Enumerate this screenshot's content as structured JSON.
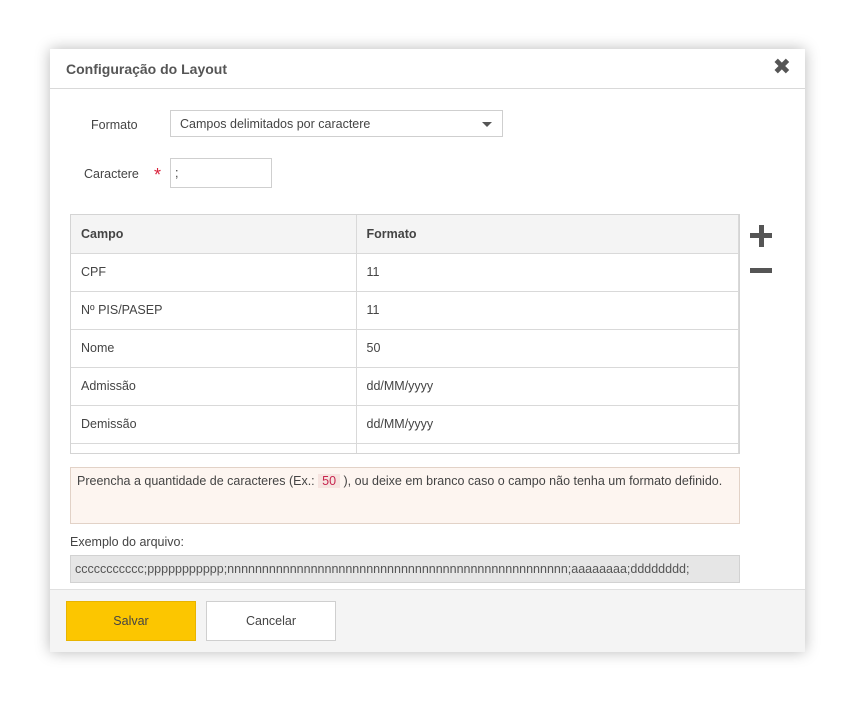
{
  "dialog": {
    "title": "Configuração do Layout",
    "close_icon": "close-icon"
  },
  "form": {
    "format_label": "Formato",
    "format_value": "Campos delimitados por caractere",
    "char_label": "Caractere",
    "char_value": ";"
  },
  "table": {
    "headers": [
      "Campo",
      "Formato"
    ],
    "rows": [
      [
        "CPF",
        "11"
      ],
      [
        "Nº PIS/PASEP",
        "11"
      ],
      [
        "Nome",
        "50"
      ],
      [
        "Admissão",
        "dd/MM/yyyy"
      ],
      [
        "Demissão",
        "dd/MM/yyyy"
      ]
    ],
    "add_icon": "plus-icon",
    "remove_icon": "minus-icon"
  },
  "hint": {
    "before": "Preencha a quantidade de caracteres (Ex.: ",
    "code": "50",
    "after": " ), ou deixe em branco caso o campo não tenha um formato definido."
  },
  "example": {
    "label": "Exemplo do arquivo:",
    "value": "ccccccccccc;ppppppppppp;nnnnnnnnnnnnnnnnnnnnnnnnnnnnnnnnnnnnnnnnnnnnnnnnn;aaaaaaaa;dddddddd;"
  },
  "footer": {
    "save_label": "Salvar",
    "cancel_label": "Cancelar"
  },
  "colors": {
    "save_button": "#fcc600",
    "required": "#d9213b",
    "hint_bg": "#fdf5f0"
  }
}
